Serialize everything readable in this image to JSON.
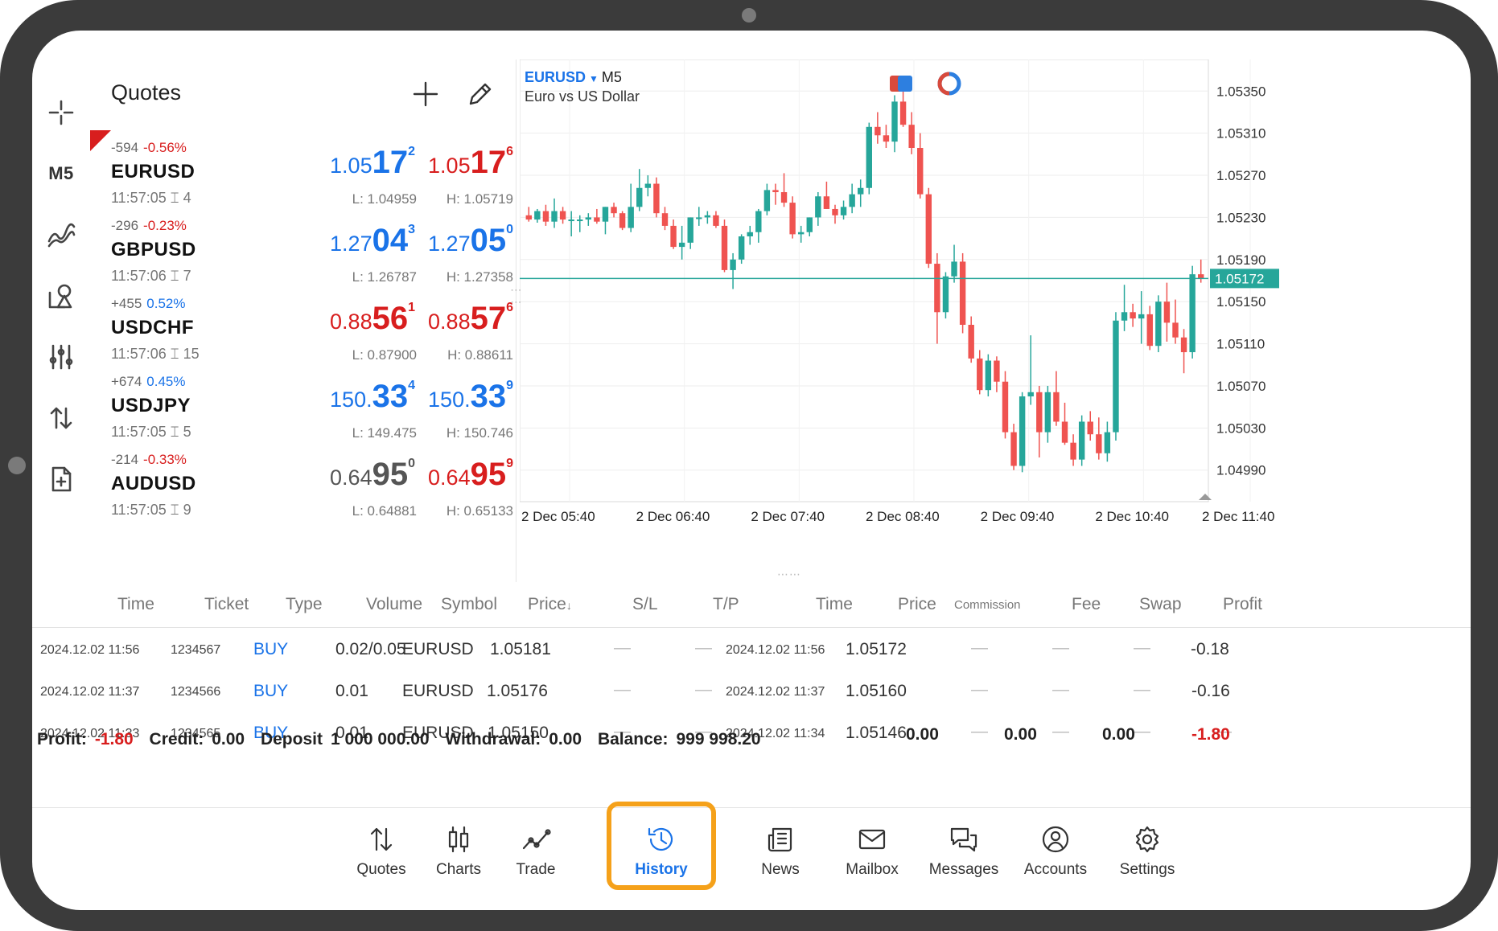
{
  "toolbar_left": {
    "timeframe": "M5",
    "icons": [
      "crosshair-icon",
      "indicators-icon",
      "objects-icon",
      "settings-sliders-icon",
      "trade-arrows-icon",
      "new-file-icon"
    ]
  },
  "quotes": {
    "title": "Quotes",
    "items": [
      {
        "change_pts": "-594",
        "change_pct": "-0.56%",
        "symbol": "EURUSD",
        "time": "11:57:05",
        "spread": "4",
        "bid_a": "1.05",
        "bid_b": "17",
        "bid_c": "2",
        "ask_a": "1.05",
        "ask_b": "17",
        "ask_c": "6",
        "low": "L: 1.04959",
        "high": "H: 1.05719"
      },
      {
        "change_pts": "-296",
        "change_pct": "-0.23%",
        "symbol": "GBPUSD",
        "time": "11:57:06",
        "spread": "7",
        "bid_a": "1.27",
        "bid_b": "04",
        "bid_c": "3",
        "ask_a": "1.27",
        "ask_b": "05",
        "ask_c": "0",
        "low": "L: 1.26787",
        "high": "H: 1.27358"
      },
      {
        "change_pts": "+455",
        "change_pct": "0.52%",
        "symbol": "USDCHF",
        "time": "11:57:06",
        "spread": "15",
        "bid_a": "0.88",
        "bid_b": "56",
        "bid_c": "1",
        "ask_a": "0.88",
        "ask_b": "57",
        "ask_c": "6",
        "low": "L: 0.87900",
        "high": "H: 0.88611"
      },
      {
        "change_pts": "+674",
        "change_pct": "0.45%",
        "symbol": "USDJPY",
        "time": "11:57:05",
        "spread": "5",
        "bid_a": "150.",
        "bid_b": "33",
        "bid_c": "4",
        "ask_a": "150.",
        "ask_b": "33",
        "ask_c": "9",
        "low": "L: 149.475",
        "high": "H: 150.746"
      },
      {
        "change_pts": "-214",
        "change_pct": "-0.33%",
        "symbol": "AUDUSD",
        "time": "11:57:05",
        "spread": "9",
        "bid_a": "0.64",
        "bid_b": "95",
        "bid_c": "0",
        "ask_a": "0.64",
        "ask_b": "95",
        "ask_c": "9",
        "low": "L: 0.64881",
        "high": "H: 0.65133"
      }
    ]
  },
  "chart": {
    "symbol": "EURUSD",
    "timeframe": "M5",
    "description": "Euro vs US Dollar",
    "current_price": "1.05172",
    "price_labels": [
      "1.05350",
      "1.05310",
      "1.05270",
      "1.05230",
      "1.05190",
      "1.05150",
      "1.05110",
      "1.05070",
      "1.05030",
      "1.04990"
    ],
    "time_labels": [
      "2 Dec 05:40",
      "2 Dec 06:40",
      "2 Dec 07:40",
      "2 Dec 08:40",
      "2 Dec 09:40",
      "2 Dec 10:40",
      "2 Dec 11:40"
    ],
    "colors": {
      "up": "#26a69a",
      "down": "#ef5350",
      "price_line": "#26a69a"
    }
  },
  "chart_data": {
    "type": "candlestick",
    "symbol": "EURUSD",
    "timeframe": "M5",
    "ylim": [
      1.0496,
      1.0538
    ],
    "x_ticks": [
      "2 Dec 05:40",
      "2 Dec 06:40",
      "2 Dec 07:40",
      "2 Dec 08:40",
      "2 Dec 09:40",
      "2 Dec 10:40",
      "2 Dec 11:40"
    ],
    "y_ticks": [
      1.0535,
      1.0531,
      1.0527,
      1.0523,
      1.0519,
      1.0515,
      1.0511,
      1.0507,
      1.0503,
      1.0499
    ],
    "current_price": 1.05172,
    "candles": [
      [
        1.05232,
        1.0524,
        1.05226,
        1.05228
      ],
      [
        1.05228,
        1.05238,
        1.05225,
        1.05236
      ],
      [
        1.05236,
        1.05242,
        1.05222,
        1.05226
      ],
      [
        1.05226,
        1.05248,
        1.0522,
        1.05236
      ],
      [
        1.05236,
        1.0524,
        1.05224,
        1.05228
      ],
      [
        1.05228,
        1.05236,
        1.05212,
        1.05228
      ],
      [
        1.05228,
        1.05232,
        1.05216,
        1.05228
      ],
      [
        1.05228,
        1.05234,
        1.05222,
        1.0523
      ],
      [
        1.0523,
        1.05238,
        1.05224,
        1.05226
      ],
      [
        1.05226,
        1.0524,
        1.05214,
        1.0524
      ],
      [
        1.0524,
        1.05244,
        1.0523,
        1.05234
      ],
      [
        1.05234,
        1.05236,
        1.05218,
        1.0522
      ],
      [
        1.0522,
        1.05262,
        1.05216,
        1.0524
      ],
      [
        1.0524,
        1.05276,
        1.05236,
        1.05258
      ],
      [
        1.05258,
        1.0527,
        1.0525,
        1.05262
      ],
      [
        1.05262,
        1.05268,
        1.0523,
        1.05234
      ],
      [
        1.05234,
        1.0524,
        1.05218,
        1.05222
      ],
      [
        1.05222,
        1.05228,
        1.052,
        1.05202
      ],
      [
        1.05202,
        1.05222,
        1.0519,
        1.05206
      ],
      [
        1.05206,
        1.0523,
        1.052,
        1.0523
      ],
      [
        1.0523,
        1.0524,
        1.05222,
        1.0523
      ],
      [
        1.0523,
        1.05236,
        1.05224,
        1.05232
      ],
      [
        1.05232,
        1.05236,
        1.0522,
        1.05222
      ],
      [
        1.05222,
        1.05228,
        1.05178,
        1.0518
      ],
      [
        1.0518,
        1.05196,
        1.05162,
        1.0519
      ],
      [
        1.0519,
        1.05214,
        1.05186,
        1.05212
      ],
      [
        1.05212,
        1.05222,
        1.05204,
        1.05216
      ],
      [
        1.05216,
        1.05238,
        1.05206,
        1.05236
      ],
      [
        1.05236,
        1.05262,
        1.05232,
        1.05256
      ],
      [
        1.05256,
        1.05262,
        1.05242,
        1.05254
      ],
      [
        1.05254,
        1.05272,
        1.0524,
        1.05244
      ],
      [
        1.05244,
        1.0525,
        1.0521,
        1.05214
      ],
      [
        1.05214,
        1.05222,
        1.05206,
        1.05216
      ],
      [
        1.05216,
        1.0523,
        1.05212,
        1.0523
      ],
      [
        1.0523,
        1.05254,
        1.05222,
        1.0525
      ],
      [
        1.0525,
        1.05264,
        1.05238,
        1.05238
      ],
      [
        1.05238,
        1.05242,
        1.05224,
        1.05232
      ],
      [
        1.05232,
        1.05246,
        1.05228,
        1.0524
      ],
      [
        1.0524,
        1.05262,
        1.05234,
        1.05252
      ],
      [
        1.05252,
        1.05266,
        1.0524,
        1.05258
      ],
      [
        1.05258,
        1.0532,
        1.05252,
        1.05316
      ],
      [
        1.05316,
        1.0533,
        1.053,
        1.05308
      ],
      [
        1.05308,
        1.05318,
        1.05296,
        1.05302
      ],
      [
        1.05302,
        1.05346,
        1.05292,
        1.0534
      ],
      [
        1.0534,
        1.05358,
        1.05316,
        1.05318
      ],
      [
        1.05318,
        1.0533,
        1.0529,
        1.05296
      ],
      [
        1.05296,
        1.0531,
        1.05248,
        1.05252
      ],
      [
        1.05252,
        1.05258,
        1.05182,
        1.05186
      ],
      [
        1.05186,
        1.05196,
        1.0511,
        1.0514
      ],
      [
        1.0514,
        1.05178,
        1.05134,
        1.05174
      ],
      [
        1.05174,
        1.05204,
        1.05168,
        1.05188
      ],
      [
        1.05188,
        1.05196,
        1.0512,
        1.05128
      ],
      [
        1.05128,
        1.05136,
        1.05092,
        1.05096
      ],
      [
        1.05096,
        1.05104,
        1.05062,
        1.05066
      ],
      [
        1.05066,
        1.051,
        1.0506,
        1.05094
      ],
      [
        1.05094,
        1.05098,
        1.05064,
        1.05074
      ],
      [
        1.05074,
        1.05084,
        1.0502,
        1.05026
      ],
      [
        1.05026,
        1.05034,
        1.0499,
        1.04994
      ],
      [
        1.04994,
        1.05064,
        1.04988,
        1.0506
      ],
      [
        1.0506,
        1.05118,
        1.05052,
        1.05064
      ],
      [
        1.05064,
        1.0507,
        1.05002,
        1.05026
      ],
      [
        1.05026,
        1.0507,
        1.05016,
        1.05064
      ],
      [
        1.05064,
        1.05084,
        1.05032,
        1.05036
      ],
      [
        1.05036,
        1.05054,
        1.05014,
        1.05016
      ],
      [
        1.05016,
        1.05024,
        1.04994,
        1.05
      ],
      [
        1.05,
        1.05042,
        1.04994,
        1.05036
      ],
      [
        1.05036,
        1.05046,
        1.05018,
        1.05024
      ],
      [
        1.05024,
        1.0504,
        1.05,
        1.05006
      ],
      [
        1.05006,
        1.05036,
        1.04998,
        1.05026
      ],
      [
        1.05026,
        1.0514,
        1.05018,
        1.05132
      ],
      [
        1.05132,
        1.05166,
        1.05122,
        1.0514
      ],
      [
        1.0514,
        1.05148,
        1.05126,
        1.05134
      ],
      [
        1.05134,
        1.0516,
        1.0511,
        1.05138
      ],
      [
        1.05138,
        1.05146,
        1.05104,
        1.05108
      ],
      [
        1.05108,
        1.05156,
        1.05102,
        1.0515
      ],
      [
        1.0515,
        1.05168,
        1.05112,
        1.0513
      ],
      [
        1.0513,
        1.05152,
        1.0511,
        1.05116
      ],
      [
        1.05116,
        1.05124,
        1.05082,
        1.05102
      ],
      [
        1.05102,
        1.05184,
        1.05096,
        1.05176
      ],
      [
        1.05176,
        1.0519,
        1.05168,
        1.05172
      ]
    ]
  },
  "history": {
    "columns": [
      "Time",
      "Ticket",
      "Type",
      "Volume",
      "Symbol",
      "Price",
      "S/L",
      "T/P",
      "Time",
      "Price",
      "Commission",
      "Fee",
      "Swap",
      "Profit"
    ],
    "price_sort_indicator": "↓",
    "rows": [
      {
        "time": "2024.12.02 11:56",
        "ticket": "1234567",
        "type": "BUY",
        "volume": "0.02/0.05",
        "symbol": "EURUSD",
        "price": "1.05181",
        "sl": "—",
        "tp": "—",
        "close_time": "2024.12.02 11:56",
        "close_price": "1.05172",
        "commission": "—",
        "fee": "—",
        "swap": "—",
        "profit": "-0.18"
      },
      {
        "time": "2024.12.02 11:37",
        "ticket": "1234566",
        "type": "BUY",
        "volume": "0.01",
        "symbol": "EURUSD",
        "price": "1.05176",
        "sl": "—",
        "tp": "—",
        "close_time": "2024.12.02 11:37",
        "close_price": "1.05160",
        "commission": "—",
        "fee": "—",
        "swap": "—",
        "profit": "-0.16"
      },
      {
        "time": "2024.12.02 11:33",
        "ticket": "1234565",
        "type": "BUY",
        "volume": "0.01",
        "symbol": "EURUSD",
        "price": "1.05150",
        "sl": "—",
        "tp": "—",
        "close_time": "2024.12.02 11:34",
        "close_price": "1.05146",
        "commission": "—",
        "fee": "—",
        "swap": "—",
        "profit": "—"
      }
    ],
    "summary": {
      "profit_label": "Profit:",
      "profit": "-1.80",
      "credit_label": "Credit:",
      "credit": "0.00",
      "deposit_label": "Deposit",
      "deposit": "1 000 000.00",
      "withdrawal_label": "Withdrawal:",
      "withdrawal": "0.00",
      "balance_label": "Balance:",
      "balance": "999 998.20"
    },
    "totals": {
      "commission": "0.00",
      "fee": "0.00",
      "swap": "0.00",
      "profit": "-1.80"
    }
  },
  "bottom_nav": {
    "active": "History",
    "highlight_color": "#f5a11a",
    "items": [
      {
        "label": "Quotes",
        "icon": "quotes-arrows-icon"
      },
      {
        "label": "Charts",
        "icon": "candles-icon"
      },
      {
        "label": "Trade",
        "icon": "trend-line-icon"
      },
      {
        "label": "History",
        "icon": "history-clock-icon"
      },
      {
        "label": "News",
        "icon": "news-icon"
      },
      {
        "label": "Mailbox",
        "icon": "mail-icon"
      },
      {
        "label": "Messages",
        "icon": "messages-icon"
      },
      {
        "label": "Accounts",
        "icon": "account-icon"
      },
      {
        "label": "Settings",
        "icon": "gear-icon"
      }
    ]
  }
}
